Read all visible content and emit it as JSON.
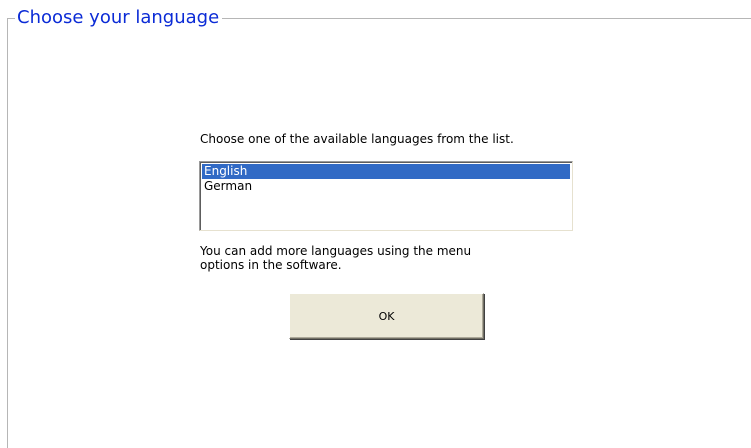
{
  "group": {
    "title": "Choose your language"
  },
  "main": {
    "instruction": "Choose one of the available languages from the list.",
    "languages": [
      {
        "label": "English",
        "selected": true
      },
      {
        "label": "German",
        "selected": false
      }
    ],
    "hint_line1": "You can add more languages using the menu",
    "hint_line2": "options in the software.",
    "ok_label": "OK"
  },
  "colors": {
    "title_text": "#0b2bd6",
    "selection": "#316ac5",
    "button_face": "#ece9d8"
  }
}
